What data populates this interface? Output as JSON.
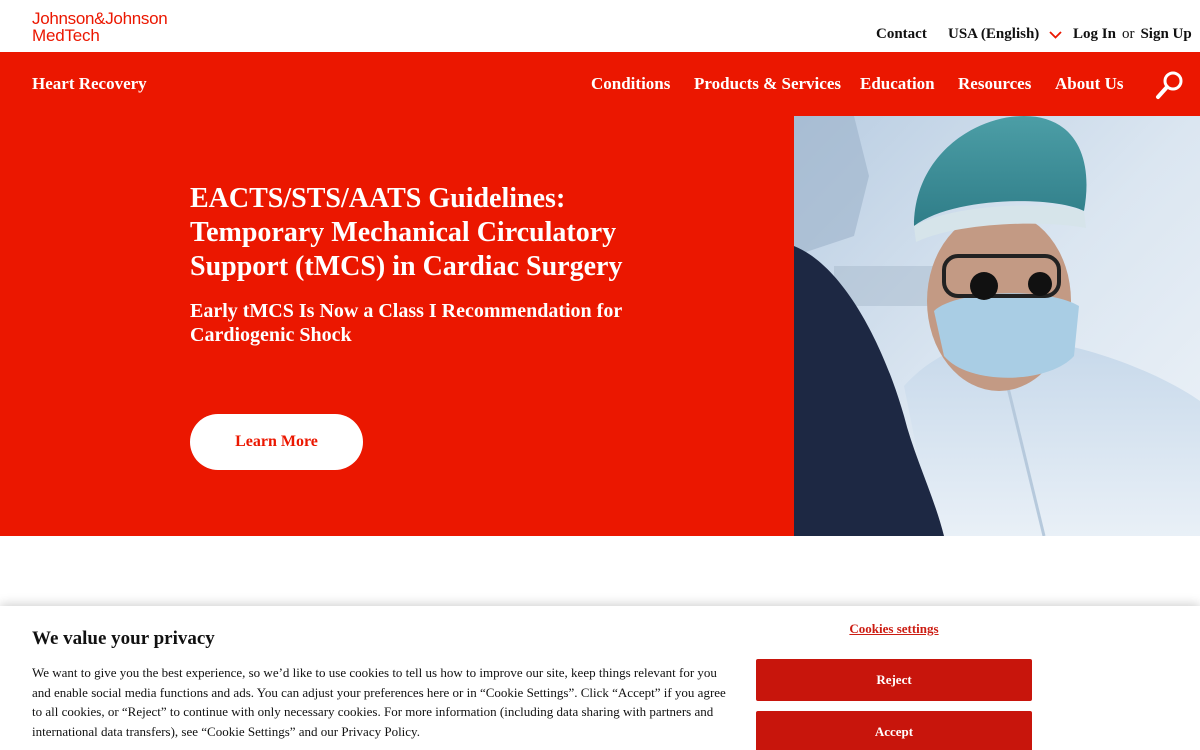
{
  "header": {
    "logo_line1": "Johnson&Johnson",
    "logo_line2": "MedTech",
    "contact": "Contact",
    "language": "USA (English)",
    "login": "Log In",
    "or": "or",
    "signup": "Sign Up"
  },
  "nav": {
    "brand": "Heart Recovery",
    "items": [
      "Conditions",
      "Products & Services",
      "Education",
      "Resources",
      "About Us"
    ]
  },
  "hero": {
    "title": "EACTS/STS/AATS Guidelines: Temporary Mechanical Circulatory Support (tMCS) in Cardiac Surgery",
    "subtitle": "Early tMCS Is Now a Class I Recommendation for Cardiogenic Shock",
    "cta": "Learn More"
  },
  "cookie": {
    "title": "We value your privacy",
    "body": "We want to give you the best experience, so we’d like to use cookies to tell us how to improve our site, keep things relevant for you and enable social media functions and ads. You can adjust your preferences here or in “Cookie Settings”. Click “Accept” if you agree to all cookies, or “Reject” to continue with only necessary cookies. For more information (including data sharing with partners and international data transfers), see “Cookie Settings” and our Privacy Policy.",
    "settings_link": "Cookies settings",
    "reject": "Reject",
    "accept": "Accept"
  },
  "colors": {
    "brand_red": "#eb1700",
    "button_red": "#c8150c"
  },
  "icons": {
    "search": "search-icon",
    "language_dropdown": "chevron-down-icon"
  }
}
